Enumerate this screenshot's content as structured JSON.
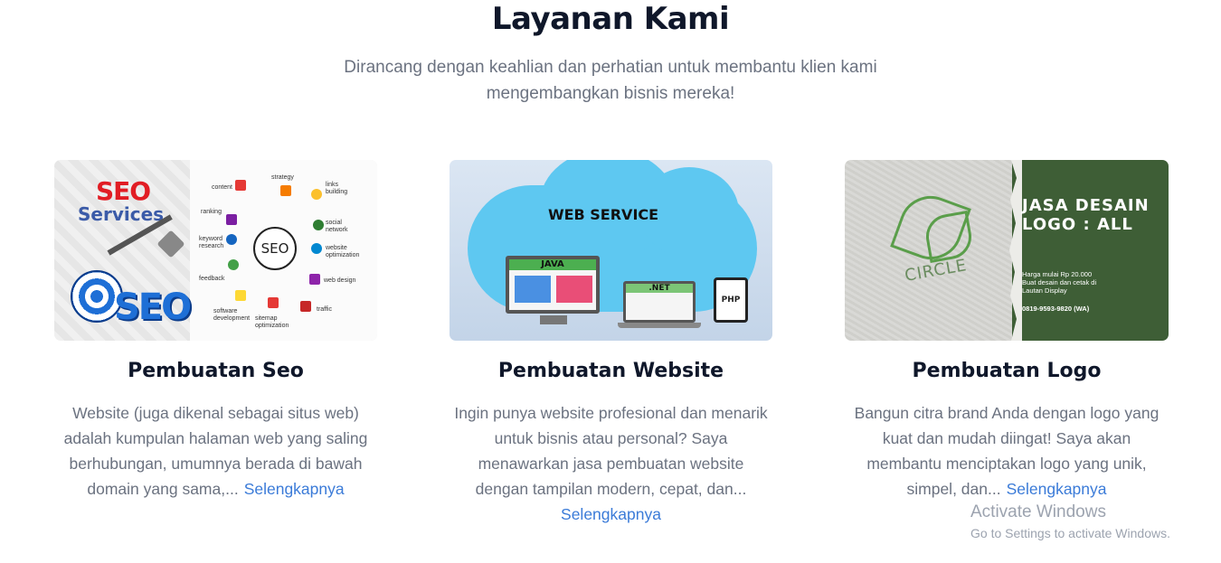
{
  "section": {
    "title": "Layanan Kami",
    "subtitle": "Dirancang dengan keahlian dan perhatian untuk membantu klien kami mengembangkan bisnis mereka!"
  },
  "services": [
    {
      "title": "Pembuatan Seo",
      "description": "Website (juga dikenal sebagai situs web) adalah kumpulan halaman web yang saling berhubungan, umumnya berada di bawah domain yang sama,...",
      "link": "Selengkapnya",
      "image": {
        "heading1": "SEO",
        "heading2": "Services",
        "hub": "SEO",
        "big": "SEO",
        "nodes": [
          "content",
          "strategy",
          "links building",
          "ranking",
          "social network",
          "keyword research",
          "website optimization",
          "feedback",
          "web design",
          "software development",
          "sitemap optimization",
          "traffic"
        ]
      }
    },
    {
      "title": "Pembuatan Website",
      "description": "Ingin punya website profesional dan menarik untuk bisnis atau personal? Saya menawarkan jasa pembuatan website dengan tampilan modern, cepat, dan...",
      "link": "Selengkapnya",
      "image": {
        "label": "WEB SERVICE",
        "monitor": "JAVA",
        "laptop": ".NET",
        "tablet": "PHP"
      }
    },
    {
      "title": "Pembuatan Logo",
      "description": "Bangun citra brand Anda dengan logo yang kuat dan mudah diingat! Saya akan membantu menciptakan logo yang unik, simpel, dan...",
      "link": "Selengkapnya",
      "image": {
        "heading": "JASA DESAIN LOGO : ALL",
        "price_line1": "Harga mulai Rp 20.000",
        "price_line2": "Buat desain dan cetak di",
        "price_line3": "Lautan Display",
        "phone": "0819-9593-9820 (WA)",
        "mark": "CIRCLE"
      }
    }
  ],
  "watermark": {
    "line1": "Activate Windows",
    "line2": "Go to Settings to activate Windows."
  },
  "colors": {
    "title": "#0f172a",
    "muted": "#6b7280",
    "link": "#3b7bd8"
  }
}
